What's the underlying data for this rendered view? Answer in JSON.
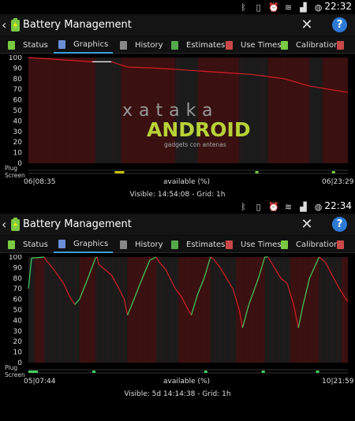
{
  "screens": [
    {
      "status_time": "22:32",
      "app_title": "Battery Management",
      "tabs": [
        "Status",
        "Graphics",
        "History",
        "Estimates",
        "Use Times",
        "Calibration"
      ],
      "active_tab": "Graphics",
      "y_ticks": [
        "100",
        "90",
        "80",
        "70",
        "60",
        "50",
        "40",
        "30",
        "20",
        "10",
        "0"
      ],
      "plug_label": "Plug",
      "screen_label": "Screen",
      "start_date": "06|08:35",
      "end_date": "06|23:29",
      "center_label": "available (%)",
      "visible_info": "Visible: 14:54:08 - Grid: 1h",
      "watermark": {
        "brand": "ANDROID",
        "prefix": "xataka",
        "tagline": "gadgets con antenas"
      },
      "colors": {
        "charge": "#ffffff",
        "discharge": "#d81f26",
        "shade_on": "#3b1010",
        "shade_off": "#1b1b1b"
      }
    },
    {
      "status_time": "22:34",
      "app_title": "Battery Management",
      "tabs": [
        "Status",
        "Graphics",
        "History",
        "Estimates",
        "Use Times",
        "Calibration"
      ],
      "active_tab": "Graphics",
      "y_ticks": [
        "100",
        "90",
        "80",
        "70",
        "60",
        "50",
        "40",
        "30",
        "20",
        "10",
        "0"
      ],
      "plug_label": "Plug",
      "screen_label": "Screen",
      "start_date": "05|07:44",
      "end_date": "10|21:59",
      "center_label": "available (%)",
      "visible_info": "Visible: 5d 14:14:38 - Grid: 1h",
      "colors": {
        "charge": "#3fd05e",
        "discharge": "#d81f26",
        "shade_on": "#3b1010",
        "shade_off": "#1b1b1b"
      }
    }
  ],
  "chart_data": [
    {
      "type": "line",
      "x_axis": "time",
      "x_start": "06|08:35",
      "x_end": "06|23:29",
      "ylabel": "available (%)",
      "ylim": [
        0,
        100
      ],
      "series": [
        {
          "values": [
            [
              0.0,
              100
            ],
            [
              0.2,
              96
            ],
            [
              0.26,
              96
            ],
            [
              0.28,
              94
            ],
            [
              0.31,
              91
            ],
            [
              0.4,
              90
            ],
            [
              0.5,
              88
            ],
            [
              0.6,
              86
            ],
            [
              0.7,
              84
            ],
            [
              0.8,
              80
            ],
            [
              0.88,
              73
            ],
            [
              0.94,
              70
            ],
            [
              1.0,
              67
            ]
          ]
        }
      ]
    },
    {
      "type": "line",
      "x_axis": "time",
      "x_start": "05|07:44",
      "x_end": "10|21:59",
      "ylabel": "available (%)",
      "ylim": [
        0,
        100
      ],
      "series": [
        {
          "values": [
            [
              0.0,
              70
            ],
            [
              0.01,
              99
            ],
            [
              0.05,
              100
            ],
            [
              0.055,
              97
            ],
            [
              0.08,
              88
            ],
            [
              0.11,
              75
            ],
            [
              0.13,
              62
            ],
            [
              0.145,
              55
            ],
            [
              0.16,
              60
            ],
            [
              0.18,
              75
            ],
            [
              0.21,
              99
            ],
            [
              0.215,
              100
            ],
            [
              0.22,
              93
            ],
            [
              0.26,
              83
            ],
            [
              0.28,
              72
            ],
            [
              0.3,
              60
            ],
            [
              0.31,
              45
            ],
            [
              0.32,
              52
            ],
            [
              0.35,
              75
            ],
            [
              0.38,
              97
            ],
            [
              0.4,
              100
            ],
            [
              0.41,
              95
            ],
            [
              0.43,
              88
            ],
            [
              0.44,
              82
            ],
            [
              0.46,
              70
            ],
            [
              0.48,
              62
            ],
            [
              0.5,
              50
            ],
            [
              0.51,
              45
            ],
            [
              0.53,
              65
            ],
            [
              0.55,
              80
            ],
            [
              0.57,
              100
            ],
            [
              0.58,
              98
            ],
            [
              0.6,
              90
            ],
            [
              0.62,
              80
            ],
            [
              0.64,
              70
            ],
            [
              0.66,
              50
            ],
            [
              0.67,
              33
            ],
            [
              0.69,
              55
            ],
            [
              0.72,
              80
            ],
            [
              0.74,
              100
            ],
            [
              0.75,
              100
            ],
            [
              0.77,
              90
            ],
            [
              0.79,
              80
            ],
            [
              0.81,
              75
            ],
            [
              0.83,
              55
            ],
            [
              0.845,
              33
            ],
            [
              0.86,
              55
            ],
            [
              0.88,
              80
            ],
            [
              0.91,
              100
            ],
            [
              0.93,
              95
            ],
            [
              0.95,
              83
            ],
            [
              0.97,
              72
            ],
            [
              0.99,
              62
            ],
            [
              1.0,
              58
            ]
          ]
        }
      ]
    }
  ]
}
